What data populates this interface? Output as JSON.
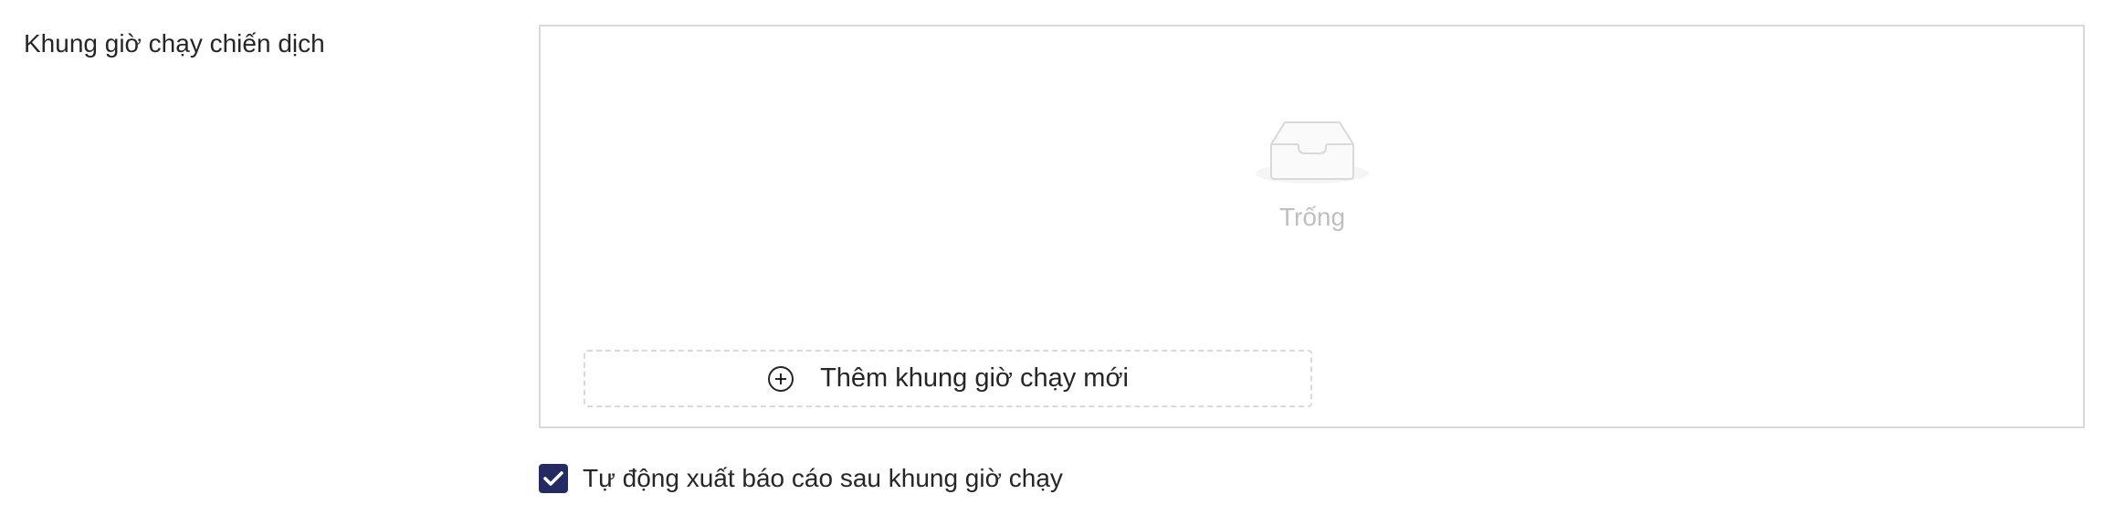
{
  "field": {
    "label": "Khung giờ chạy chiến dịch"
  },
  "schedule_list": {
    "empty_text": "Trống",
    "empty_icon": "inbox-icon",
    "add_button_label": "Thêm khung giờ chạy mới",
    "add_button_icon": "plus-circle-icon"
  },
  "auto_report": {
    "checked": true,
    "label": "Tự động xuất báo cáo sau khung giờ chạy"
  },
  "colors": {
    "checkbox_fill": "#252a63",
    "border": "#d9d9d9",
    "empty_text": "#bfbfbf"
  }
}
